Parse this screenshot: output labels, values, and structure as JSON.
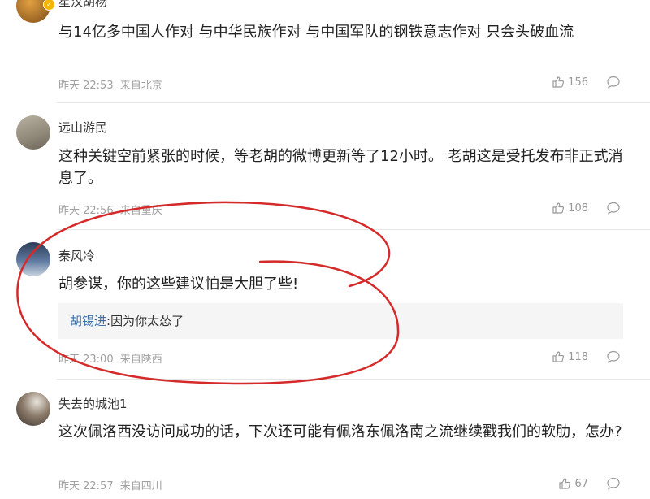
{
  "comments": [
    {
      "username": "星汉胡杨",
      "text": "与14亿多中国人作对 与中华民族作对 与中国军队的钢铁意志作对 只会头破血流",
      "time": "昨天 22:53",
      "location": "来自北京",
      "likes": "156",
      "verified": true
    },
    {
      "username": "远山游民",
      "text": "这种关键空前紧张的时候，等老胡的微博更新等了12小时。 老胡这是受托发布非正式消息了。",
      "time": "昨天 22:56",
      "location": "来自重庆",
      "likes": "108"
    },
    {
      "username": "秦风冷",
      "text": "胡参谋，你的这些建议怕是大胆了些!",
      "reply": {
        "name": "胡锡进",
        "text": ":因为你太怂了"
      },
      "time": "昨天 23:00",
      "location": "来自陕西",
      "likes": "118"
    },
    {
      "username": "失去的城池1",
      "text": "这次佩洛西没访问成功的话，下次还可能有佩洛东佩洛南之流继续戳我们的软肋，怎办?",
      "time": "昨天 22:57",
      "location": "来自四川",
      "likes": "67"
    }
  ],
  "icons": {
    "like": "thumbs-up-icon",
    "comment": "comment-bubble-icon",
    "verified": "verified-badge-icon"
  },
  "colors": {
    "annotation": "#d42a2a",
    "reply_name": "#3d6ea8",
    "meta": "#a0a0a0"
  }
}
